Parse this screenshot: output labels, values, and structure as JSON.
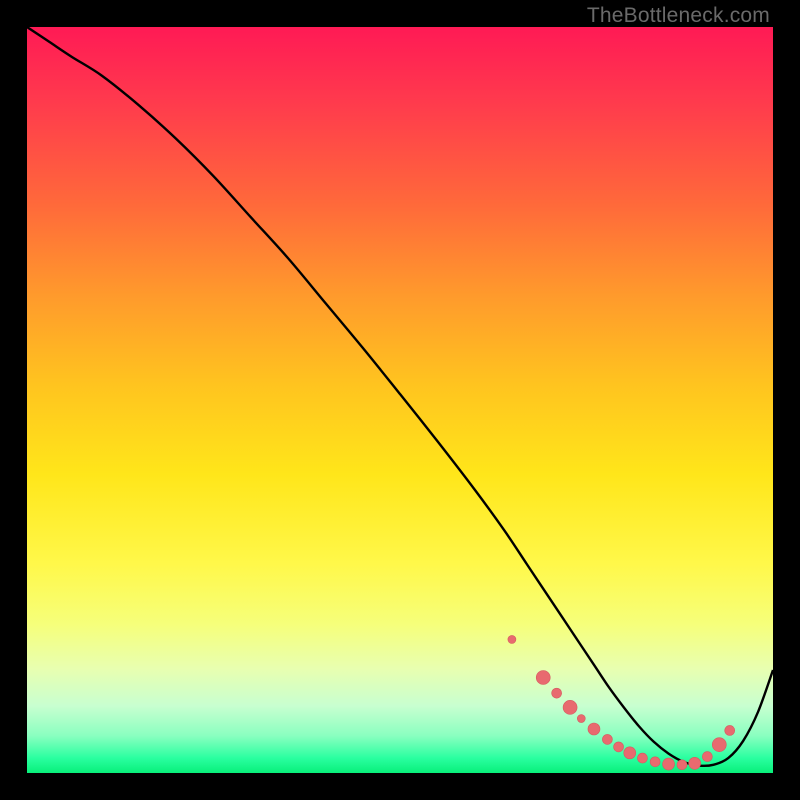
{
  "watermark": "TheBottleneck.com",
  "colors": {
    "curve": "#000000",
    "dot_fill": "#e86a6f",
    "dot_stroke": "#d65a60"
  },
  "chart_data": {
    "type": "line",
    "title": "",
    "xlabel": "",
    "ylabel": "",
    "xlim": [
      0,
      100
    ],
    "ylim": [
      0,
      100
    ],
    "grid": false,
    "series": [
      {
        "name": "bottleneck-curve",
        "x": [
          0,
          3,
          6,
          10,
          15,
          20,
          25,
          30,
          35,
          40,
          45,
          50,
          55,
          60,
          64,
          67,
          70,
          73,
          76,
          78,
          80,
          82,
          84,
          86,
          88,
          90,
          92,
          94,
          96,
          98,
          100
        ],
        "y": [
          100,
          98,
          96,
          93.5,
          89.5,
          85,
          80,
          74.5,
          69,
          63,
          57,
          50.8,
          44.5,
          38,
          32.5,
          28,
          23.5,
          19,
          14.5,
          11.5,
          8.8,
          6.3,
          4.2,
          2.6,
          1.5,
          1.0,
          1.1,
          2.0,
          4.3,
          8.2,
          13.8
        ]
      }
    ],
    "markers": {
      "name": "highlight-dots",
      "points": [
        {
          "x": 65.0,
          "y": 17.9,
          "r": 4
        },
        {
          "x": 69.2,
          "y": 12.8,
          "r": 7
        },
        {
          "x": 71.0,
          "y": 10.7,
          "r": 5
        },
        {
          "x": 72.8,
          "y": 8.8,
          "r": 7
        },
        {
          "x": 74.3,
          "y": 7.3,
          "r": 4
        },
        {
          "x": 76.0,
          "y": 5.9,
          "r": 6
        },
        {
          "x": 77.8,
          "y": 4.5,
          "r": 5
        },
        {
          "x": 79.3,
          "y": 3.5,
          "r": 5
        },
        {
          "x": 80.8,
          "y": 2.7,
          "r": 6
        },
        {
          "x": 82.5,
          "y": 2.0,
          "r": 5
        },
        {
          "x": 84.2,
          "y": 1.5,
          "r": 5
        },
        {
          "x": 86.0,
          "y": 1.2,
          "r": 6
        },
        {
          "x": 87.8,
          "y": 1.1,
          "r": 5
        },
        {
          "x": 89.5,
          "y": 1.3,
          "r": 6
        },
        {
          "x": 91.2,
          "y": 2.2,
          "r": 5
        },
        {
          "x": 92.8,
          "y": 3.8,
          "r": 7
        },
        {
          "x": 94.2,
          "y": 5.7,
          "r": 5
        }
      ]
    }
  }
}
